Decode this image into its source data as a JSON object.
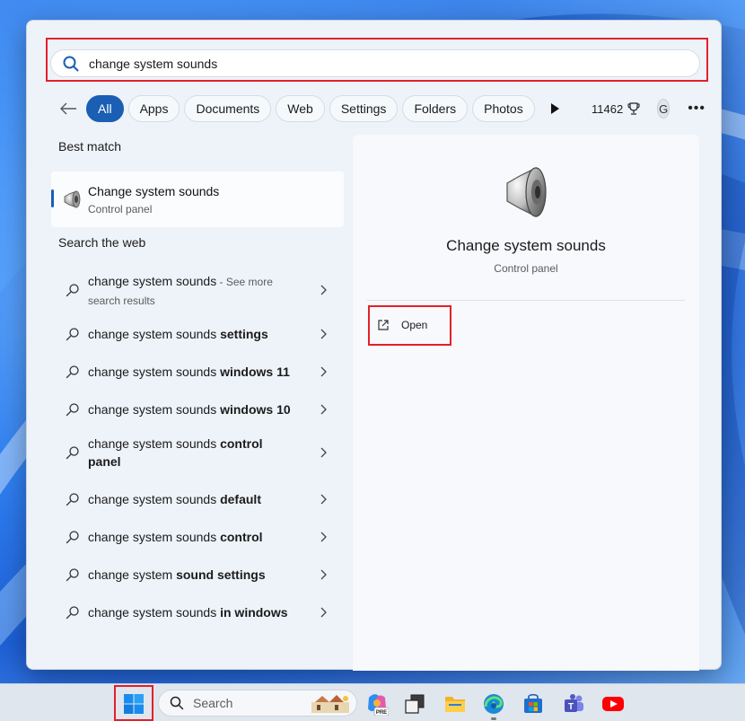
{
  "search": {
    "query": "change system sounds"
  },
  "filters": {
    "items": [
      "All",
      "Apps",
      "Documents",
      "Web",
      "Settings",
      "Folders",
      "Photos"
    ],
    "points": "11462",
    "avatar_letter": "G"
  },
  "best_match": {
    "heading": "Best match",
    "title": "Change system sounds",
    "subtitle": "Control panel"
  },
  "web": {
    "heading": "Search the web",
    "items": [
      {
        "base": "change system sounds",
        "bold": "",
        "suffix": " - See more search results"
      },
      {
        "base": "change system sounds ",
        "bold": "settings",
        "suffix": ""
      },
      {
        "base": "change system sounds ",
        "bold": "windows 11",
        "suffix": ""
      },
      {
        "base": "change system sounds ",
        "bold": "windows 10",
        "suffix": ""
      },
      {
        "base": "change system sounds ",
        "bold": "control panel",
        "suffix": ""
      },
      {
        "base": "change system sounds ",
        "bold": "default",
        "suffix": ""
      },
      {
        "base": "change system sounds ",
        "bold": "control",
        "suffix": ""
      },
      {
        "base": "change system ",
        "bold": "sound settings",
        "suffix": ""
      },
      {
        "base": "change system sounds ",
        "bold": "in windows",
        "suffix": ""
      }
    ]
  },
  "preview": {
    "title": "Change system sounds",
    "subtitle": "Control panel",
    "open_label": "Open"
  },
  "taskbar": {
    "search_label": "Search",
    "apps": [
      "copilot-pre-icon",
      "task-view-icon",
      "file-explorer-icon",
      "edge-icon",
      "microsoft-store-icon",
      "teams-icon",
      "youtube-icon"
    ]
  },
  "colors": {
    "accent": "#1a5fb4",
    "highlight_frame": "#e3202a"
  }
}
